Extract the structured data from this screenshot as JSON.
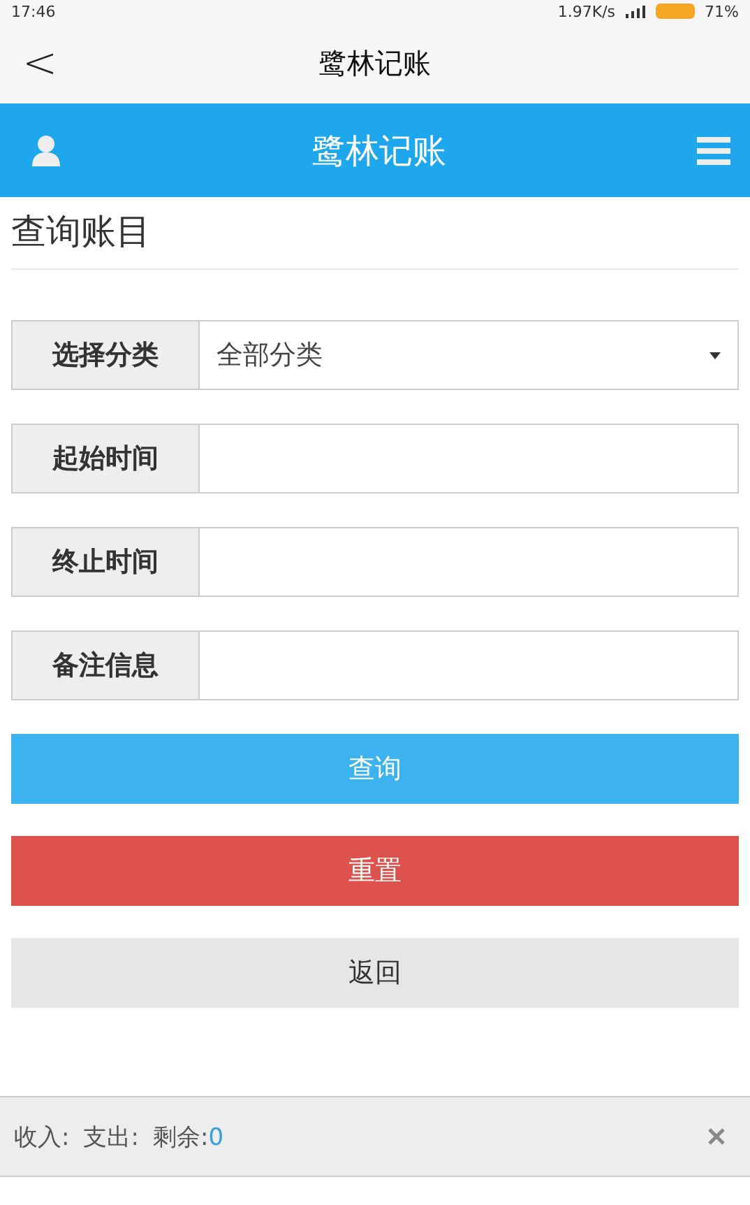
{
  "status_bar": {
    "time": "17:46",
    "speed": "1.97K/s",
    "battery": "71%"
  },
  "title_bar": {
    "back": "<",
    "title": "鹭林记账"
  },
  "header": {
    "title": "鹭林记账"
  },
  "page_heading": "查询账目",
  "form": [
    {
      "kind": "select",
      "label": "选择分类",
      "value": "全部分类"
    },
    {
      "kind": "input",
      "label": "起始时间"
    },
    {
      "kind": "input",
      "label": "终止时间"
    },
    {
      "kind": "input",
      "label": "备注信息"
    }
  ],
  "buttons": [
    {
      "kind": "primary",
      "label": "查询"
    },
    {
      "kind": "danger",
      "label": "重置"
    },
    {
      "kind": "default",
      "label": "返回"
    }
  ],
  "footer": {
    "income_label": "收入:",
    "expense_label": "支出:",
    "balance_label": "剩余:",
    "balance_value": "0"
  }
}
